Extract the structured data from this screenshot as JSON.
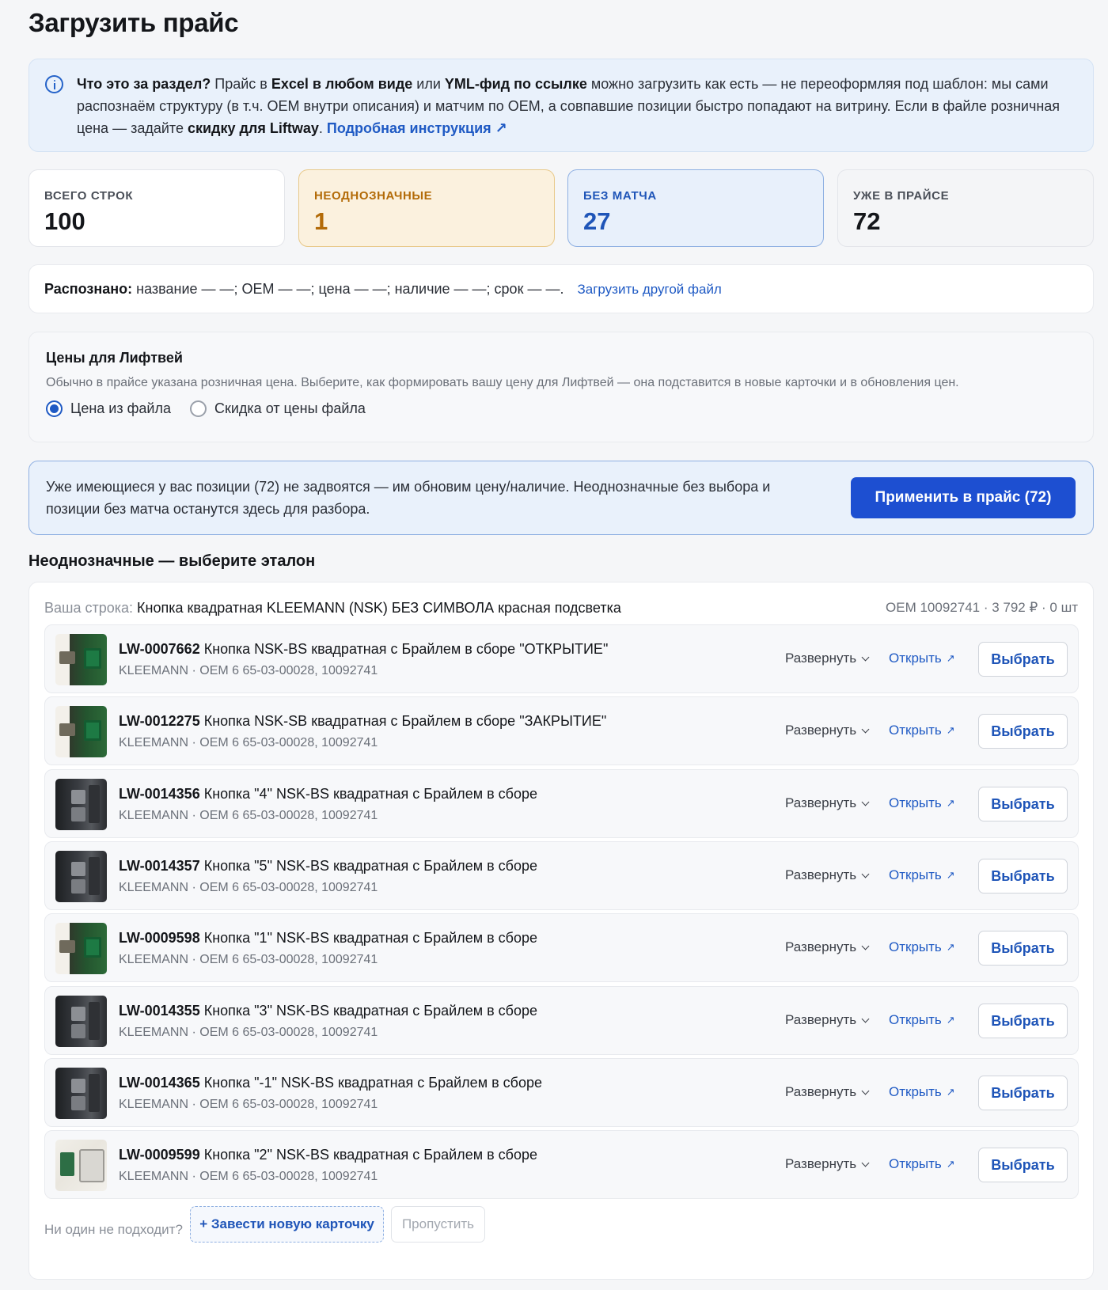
{
  "page": {
    "title": "Загрузить прайс"
  },
  "info": {
    "q": "Что это за раздел?",
    "t1": " Прайс в ",
    "b1": "Excel в любом виде",
    "t2": " или ",
    "b2": "YML-фид по ссылке",
    "t3": " можно загрузить как есть — не переоформляя под шаблон: мы сами распознаём структуру (в т.ч. OEM внутри описания) и матчим по OEM, а совпавшие позиции быстро попадают на витрину. Если в файле розничная цена — задайте ",
    "b3": "скидку для Liftway",
    "t4": ". ",
    "link": "Подробная инструкция ↗"
  },
  "stats": [
    {
      "label": "ВСЕГО СТРОК",
      "value": "100"
    },
    {
      "label": "НЕОДНОЗНАЧНЫЕ",
      "value": "1"
    },
    {
      "label": "БЕЗ МАТЧА",
      "value": "27"
    },
    {
      "label": "УЖЕ В ПРАЙСЕ",
      "value": "72"
    }
  ],
  "recognized": {
    "label": "Распознано:",
    "text": " название — —; OEM — —; цена — —; наличие — —; срок — —.",
    "link": "Загрузить другой файл"
  },
  "prices": {
    "title": "Цены для Лифтвей",
    "desc": "Обычно в прайсе указана розничная цена. Выберите, как формировать вашу цену для Лифтвей — она подставится в новые карточки и в обновления цен.",
    "opt1": "Цена из файла",
    "opt2": "Скидка от цены файла"
  },
  "apply": {
    "text": "Уже имеющиеся у вас позиции (72) не задвоятся — им обновим цену/наличие. Неоднозначные без выбора и позиции без матча останутся здесь для разбора.",
    "button": "Применить в прайс (72)"
  },
  "ambiguous": {
    "heading": "Неоднозначные — выберите эталон",
    "yours_prefix": "Ваша строка: ",
    "yours_name": "Кнопка квадратная KLEEMANN (NSK) БЕЗ СИМВОЛА красная подсветка",
    "yours_meta": "OEM 10092741 · 3 792 ₽ · 0 шт",
    "expand_label": "Развернуть",
    "open_label": "Открыть",
    "pick_label": "Выбрать",
    "none_label": "Ни один не подходит?",
    "new_card": "+ Завести новую карточку",
    "skip": "Пропустить",
    "candidates": [
      {
        "code": "LW-0007662",
        "name": " Кнопка NSK-BS квадратная с Брайлем в сборе \"ОТКРЫТИЕ\"",
        "sub": "KLEEMANN · OEM 6 65-03-00028, 10092741",
        "thumb": "t-green"
      },
      {
        "code": "LW-0012275",
        "name": " Кнопка NSK-SB квадратная с Брайлем в сборе \"ЗАКРЫТИЕ\"",
        "sub": "KLEEMANN · OEM 6 65-03-00028, 10092741",
        "thumb": "t-green"
      },
      {
        "code": "LW-0014356",
        "name": " Кнопка \"4\" NSK-BS квадратная с Брайлем в сборе",
        "sub": "KLEEMANN · OEM 6 65-03-00028, 10092741",
        "thumb": "t-dark"
      },
      {
        "code": "LW-0014357",
        "name": " Кнопка \"5\" NSK-BS квадратная с Брайлем в сборе",
        "sub": "KLEEMANN · OEM 6 65-03-00028, 10092741",
        "thumb": "t-dark"
      },
      {
        "code": "LW-0009598",
        "name": " Кнопка \"1\" NSK-BS квадратная с Брайлем в сборе",
        "sub": "KLEEMANN · OEM 6 65-03-00028, 10092741",
        "thumb": "t-green"
      },
      {
        "code": "LW-0014355",
        "name": " Кнопка \"3\" NSK-BS квадратная с Брайлем в сборе",
        "sub": "KLEEMANN · OEM 6 65-03-00028, 10092741",
        "thumb": "t-dark"
      },
      {
        "code": "LW-0014365",
        "name": " Кнопка \"-1\" NSK-BS квадратная с Брайлем в сборе",
        "sub": "KLEEMANN · OEM 6 65-03-00028, 10092741",
        "thumb": "t-dark"
      },
      {
        "code": "LW-0009599",
        "name": " Кнопка \"2\" NSK-BS квадратная с Брайлем в сборе",
        "sub": "KLEEMANN · OEM 6 65-03-00028, 10092741",
        "thumb": "t-pcb"
      }
    ]
  }
}
